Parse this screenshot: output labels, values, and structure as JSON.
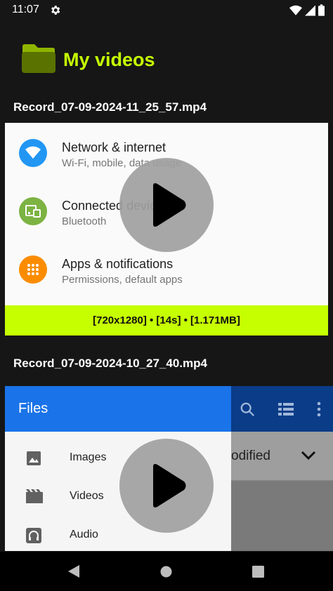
{
  "status_bar": {
    "time": "11:07"
  },
  "header": {
    "title": "My videos"
  },
  "videos": [
    {
      "file_name": "Record_07-09-2024-11_25_57.mp4",
      "meta": "[720x1280] • [14s] • [1.171MB]",
      "preview": {
        "items": [
          {
            "title": "Network & internet",
            "subtitle": "Wi-Fi, mobile, data usage"
          },
          {
            "title": "Connected devices",
            "subtitle": "Bluetooth"
          },
          {
            "title": "Apps & notifications",
            "subtitle": "Permissions, default apps"
          }
        ]
      }
    },
    {
      "file_name": "Record_07-09-2024-10_27_40.mp4",
      "preview": {
        "drawer_title": "Files",
        "sort_label": "odified",
        "drawer_items": [
          "Images",
          "Videos",
          "Audio"
        ]
      }
    }
  ],
  "colors": {
    "accent": "#c6ff00",
    "background": "#161616",
    "wifi": "#2196f3",
    "devices": "#7cb342",
    "apps": "#fb8c00",
    "drawer_header": "#1a73e8"
  }
}
